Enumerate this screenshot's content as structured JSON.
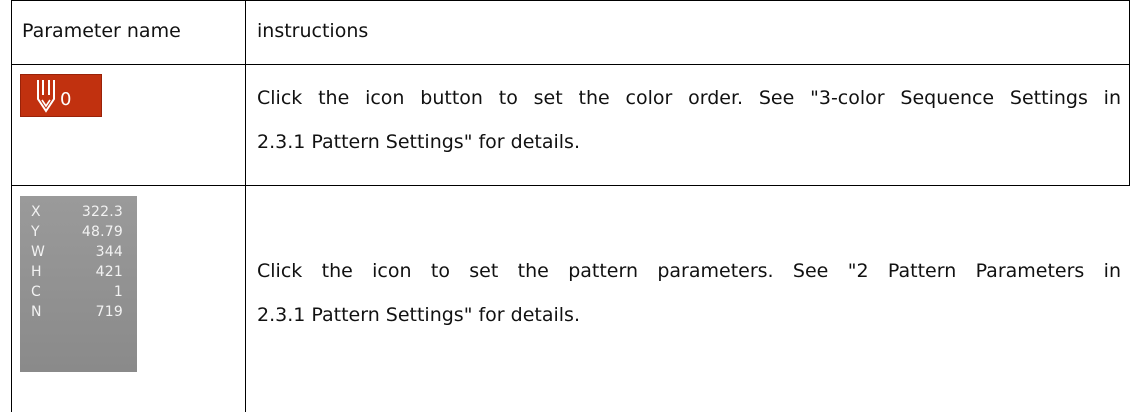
{
  "table": {
    "header": {
      "name": "Parameter name",
      "instructions": "instructions"
    },
    "rows": [
      {
        "icon": {
          "name": "needle-icon",
          "number": "0",
          "background": "#c1310f"
        },
        "instruction_lines": [
          "Click the icon button to set the color order. See \"3-color Sequence Settings in",
          "2.3.1 Pattern Settings\" for details."
        ]
      },
      {
        "panel": {
          "params": [
            {
              "key": "X",
              "value": "322.3"
            },
            {
              "key": "Y",
              "value": "48.79"
            },
            {
              "key": "W",
              "value": "344"
            },
            {
              "key": "H",
              "value": "421"
            },
            {
              "key": "C",
              "value": "1"
            },
            {
              "key": "N",
              "value": "719"
            }
          ]
        },
        "instruction_lines": [
          "Click the icon to set the pattern parameters. See \"2 Pattern Parameters in",
          "2.3.1 Pattern Settings\" for details."
        ]
      }
    ]
  }
}
